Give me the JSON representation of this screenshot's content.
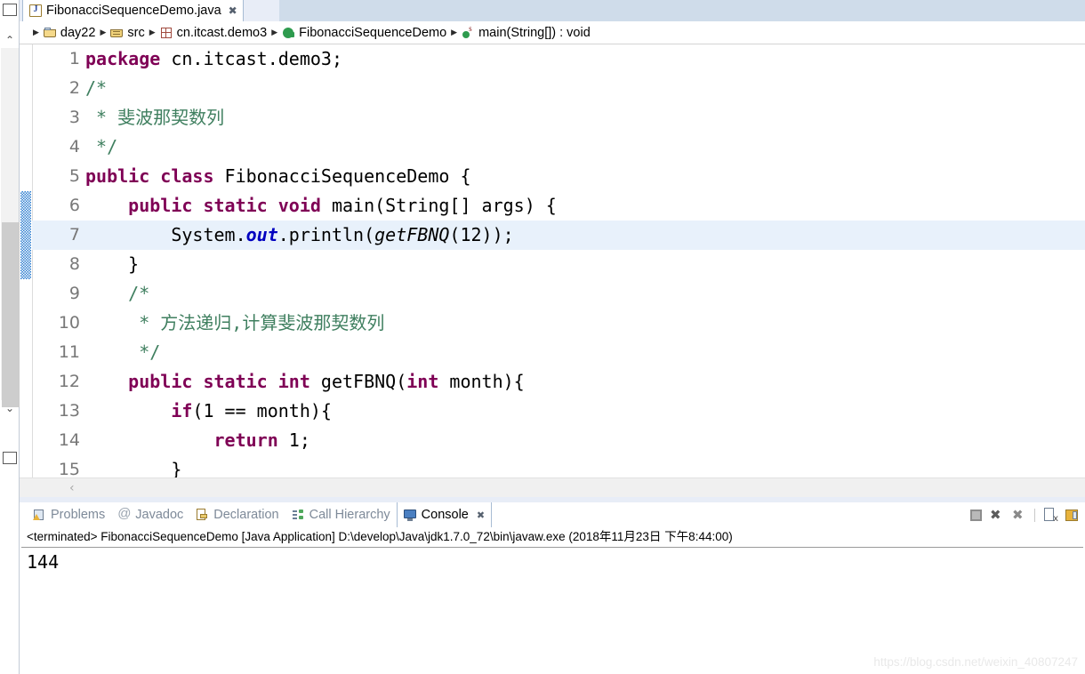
{
  "window": {
    "watermark": "https://blog.csdn.net/weixin_40807247"
  },
  "editor": {
    "tab": {
      "title": "FibonacciSequenceDemo.java",
      "close_glyph": "✖",
      "icon": "java-file-icon"
    },
    "breadcrumb": {
      "separator": "▶",
      "items": [
        {
          "label": "day22",
          "icon": "project-folder-icon"
        },
        {
          "label": "src",
          "icon": "source-folder-icon"
        },
        {
          "label": "cn.itcast.demo3",
          "icon": "package-icon"
        },
        {
          "label": "FibonacciSequenceDemo",
          "icon": "class-icon"
        },
        {
          "label": "main(String[]) : void",
          "icon": "method-icon"
        }
      ]
    },
    "highlighted_line": 7,
    "occurrence_marker_lines": [
      6,
      7,
      8
    ],
    "lines": [
      {
        "num": "1",
        "tokens": [
          {
            "t": "package",
            "c": "kw"
          },
          {
            "t": " cn.itcast.demo3;",
            "c": ""
          }
        ]
      },
      {
        "num": "2",
        "tokens": [
          {
            "t": "/*",
            "c": "cmt"
          }
        ]
      },
      {
        "num": "3",
        "tokens": [
          {
            "t": " * 斐波那契数列",
            "c": "cmt"
          }
        ]
      },
      {
        "num": "4",
        "tokens": [
          {
            "t": " */",
            "c": "cmt"
          }
        ]
      },
      {
        "num": "5",
        "tokens": [
          {
            "t": "public class",
            "c": "kw"
          },
          {
            "t": " FibonacciSequenceDemo {",
            "c": ""
          }
        ]
      },
      {
        "num": "6",
        "tokens": [
          {
            "t": "    ",
            "c": ""
          },
          {
            "t": "public static void",
            "c": "kw"
          },
          {
            "t": " main(String[] args) {",
            "c": ""
          }
        ]
      },
      {
        "num": "7",
        "tokens": [
          {
            "t": "        System.",
            "c": ""
          },
          {
            "t": "out",
            "c": "stf"
          },
          {
            "t": ".println(",
            "c": ""
          },
          {
            "t": "getFBNQ",
            "c": "stm"
          },
          {
            "t": "(12));",
            "c": ""
          }
        ]
      },
      {
        "num": "8",
        "tokens": [
          {
            "t": "    }",
            "c": ""
          }
        ]
      },
      {
        "num": "9",
        "tokens": [
          {
            "t": "    ",
            "c": ""
          },
          {
            "t": "/*",
            "c": "cmt"
          }
        ]
      },
      {
        "num": "10",
        "tokens": [
          {
            "t": "     ",
            "c": ""
          },
          {
            "t": "* 方法递归,计算斐波那契数列",
            "c": "cmt"
          }
        ]
      },
      {
        "num": "11",
        "tokens": [
          {
            "t": "     ",
            "c": ""
          },
          {
            "t": "*/",
            "c": "cmt"
          }
        ]
      },
      {
        "num": "12",
        "tokens": [
          {
            "t": "    ",
            "c": ""
          },
          {
            "t": "public static int",
            "c": "kw"
          },
          {
            "t": " getFBNQ(",
            "c": ""
          },
          {
            "t": "int",
            "c": "kw"
          },
          {
            "t": " month){",
            "c": ""
          }
        ]
      },
      {
        "num": "13",
        "tokens": [
          {
            "t": "        ",
            "c": ""
          },
          {
            "t": "if",
            "c": "kw"
          },
          {
            "t": "(1 == month){",
            "c": ""
          }
        ]
      },
      {
        "num": "14",
        "tokens": [
          {
            "t": "            ",
            "c": ""
          },
          {
            "t": "return",
            "c": "kw"
          },
          {
            "t": " 1;",
            "c": ""
          }
        ]
      },
      {
        "num": "15",
        "tokens": [
          {
            "t": "        }",
            "c": ""
          }
        ]
      }
    ],
    "hscroll_chevron": "‹"
  },
  "console_view": {
    "tabs": [
      {
        "label": "Problems",
        "icon": "problems-icon",
        "active": false
      },
      {
        "label": "Javadoc",
        "icon": "javadoc-icon",
        "active": false
      },
      {
        "label": "Declaration",
        "icon": "declaration-icon",
        "active": false
      },
      {
        "label": "Call Hierarchy",
        "icon": "call-hierarchy-icon",
        "active": false
      },
      {
        "label": "Console",
        "icon": "console-icon",
        "active": true
      }
    ],
    "active_tab_close_glyph": "✖",
    "toolbar": [
      {
        "name": "terminate-button",
        "glyph": ""
      },
      {
        "name": "remove-launch-button",
        "glyph": "✖"
      },
      {
        "name": "remove-all-terminated-button",
        "glyph": "✖"
      },
      {
        "name": "clear-console-button",
        "glyph": ""
      },
      {
        "name": "scroll-lock-button",
        "glyph": ""
      }
    ],
    "status_line": "<terminated> FibonacciSequenceDemo [Java Application] D:\\develop\\Java\\jdk1.7.0_72\\bin\\javaw.exe (2018年11月23日 下午8:44:00)",
    "output": "144"
  },
  "left_bar": {
    "restore_top": "restore-view-icon",
    "restore_bottom": "restore-view-icon",
    "chevron_up": "⌃",
    "chevron_down": "⌄"
  }
}
